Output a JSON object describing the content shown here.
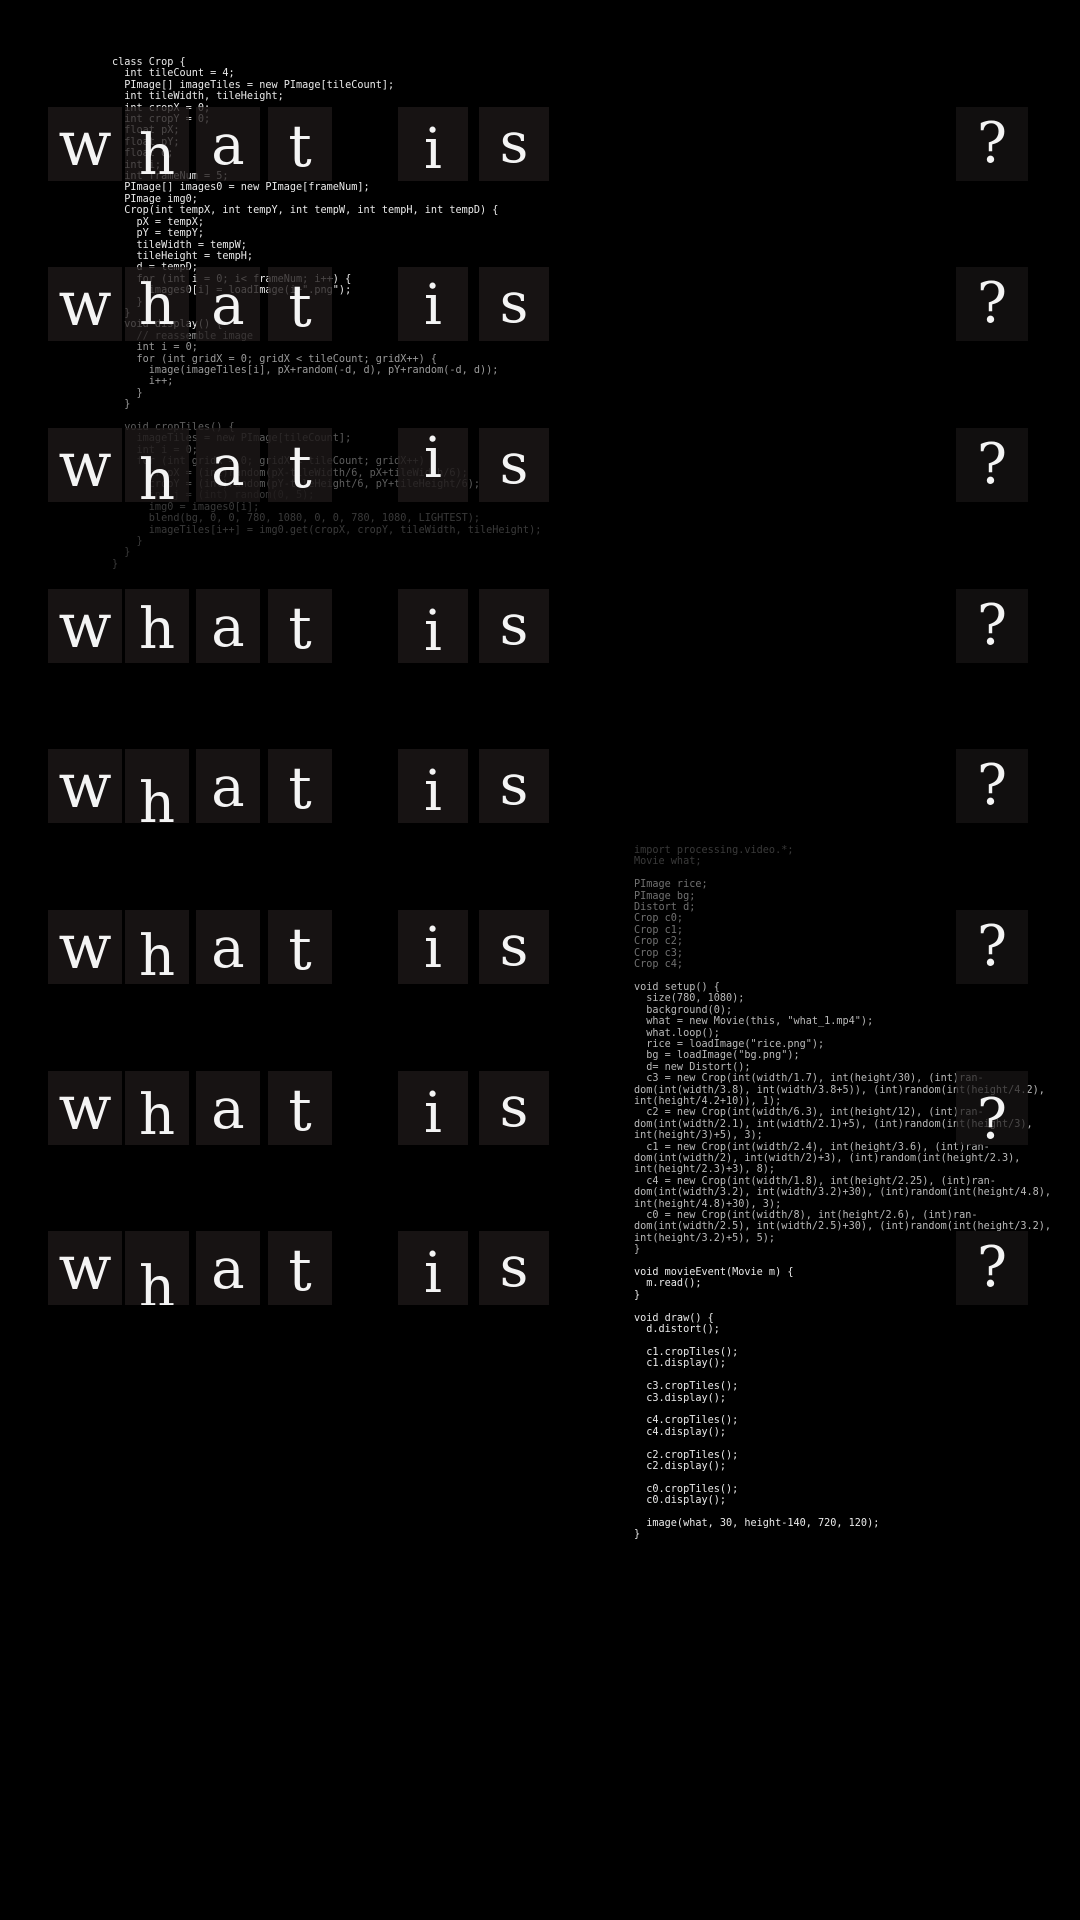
{
  "phrase": {
    "word1": [
      "w",
      "h",
      "a",
      "t"
    ],
    "word2": [
      "i",
      "s"
    ],
    "mark": "?"
  },
  "code_left": [
    "class Crop {",
    "  int tileCount = 4;",
    "  PImage[] imageTiles = new PImage[tileCount];",
    "  int tileWidth, tileHeight;",
    "  int cropX = 0;",
    "  int cropY = 0;",
    "  float pX;",
    "  float pY;",
    "  float d;",
    "  int i;",
    "  int frameNum = 5;",
    "  PImage[] images0 = new PImage[frameNum];",
    "  PImage img0;",
    "  Crop(int tempX, int tempY, int tempW, int tempH, int tempD) {",
    "    pX = tempX;",
    "    pY = tempY;",
    "    tileWidth = tempW;",
    "    tileHeight = tempH;",
    "    d = tempD;",
    "    for (int i = 0; i< frameNum; i++) {",
    "      images0[i] = loadImage(i+\".png\");",
    "    }",
    "  }",
    "  void display() {",
    "    // reassemble image",
    "    int i = 0;",
    "    for (int gridX = 0; gridX < tileCount; gridX++) {",
    "      image(imageTiles[i], pX+random(-d, d), pY+random(-d, d));",
    "      i++;",
    "    }",
    "  }",
    "",
    "  void cropTiles() {",
    "    imageTiles = new PImage[tileCount];",
    "    int i = 0;",
    "    for (int gridX = 0; gridX < tileCount; gridX++) {",
    "      cropX = (int)random(pX-tileWidth/6, pX+tileWidth/6);",
    "      cropY = (int)random(pY-tileHeight/6, pY+tileHeight/6);",
    "      int j = (int) random(0, 5);",
    "      img0 = images0[i];",
    "      blend(bg, 0, 0, 780, 1080, 0, 0, 780, 1080, LIGHTEST);",
    "      imageTiles[i++] = img0.get(cropX, cropY, tileWidth, tileHeight);",
    "    }",
    "  }",
    "}"
  ],
  "code_right": [
    "import processing.video.*;",
    "Movie what;",
    "",
    "PImage rice;",
    "PImage bg;",
    "Distort d;",
    "Crop c0;",
    "Crop c1;",
    "Crop c2;",
    "Crop c3;",
    "Crop c4;",
    "",
    "void setup() {",
    "  size(780, 1080);",
    "  background(0);",
    "  what = new Movie(this, \"what_1.mp4\");",
    "  what.loop();",
    "  rice = loadImage(\"rice.png\");",
    "  bg = loadImage(\"bg.png\");",
    "  d= new Distort();",
    "  c3 = new Crop(int(width/1.7), int(height/30), (int)ran-",
    "dom(int(width/3.8), int(width/3.8+5)), (int)random(int(height/4.2),",
    "int(height/4.2+10)), 1);",
    "  c2 = new Crop(int(width/6.3), int(height/12), (int)ran-",
    "dom(int(width/2.1), int(width/2.1)+5), (int)random(int(height/3),",
    "int(height/3)+5), 3);",
    "  c1 = new Crop(int(width/2.4), int(height/3.6), (int)ran-",
    "dom(int(width/2), int(width/2)+3), (int)random(int(height/2.3),",
    "int(height/2.3)+3), 8);",
    "  c4 = new Crop(int(width/1.8), int(height/2.25), (int)ran-",
    "dom(int(width/3.2), int(width/3.2)+30), (int)random(int(height/4.8),",
    "int(height/4.8)+30), 3);",
    "  c0 = new Crop(int(width/8), int(height/2.6), (int)ran-",
    "dom(int(width/2.5), int(width/2.5)+30), (int)random(int(height/3.2),",
    "int(height/3.2)+5), 5);",
    "}",
    "",
    "void movieEvent(Movie m) {",
    "  m.read();",
    "}",
    "",
    "void draw() {",
    "  d.distort();",
    "",
    "  c1.cropTiles();",
    "  c1.display();",
    "",
    "  c3.cropTiles();",
    "  c3.display();",
    "",
    "  c4.cropTiles();",
    "  c4.display();",
    "",
    "  c2.cropTiles();",
    "  c2.display();",
    "",
    "  c0.cropTiles();",
    "  c0.display();",
    "",
    "  image(what, 30, height-140, 720, 120);",
    "}"
  ],
  "colors": {
    "background": "#000000",
    "letters": "#f4f4f4",
    "code_bright": "#e9e9e9",
    "code_dim": "#3a3a3a"
  }
}
